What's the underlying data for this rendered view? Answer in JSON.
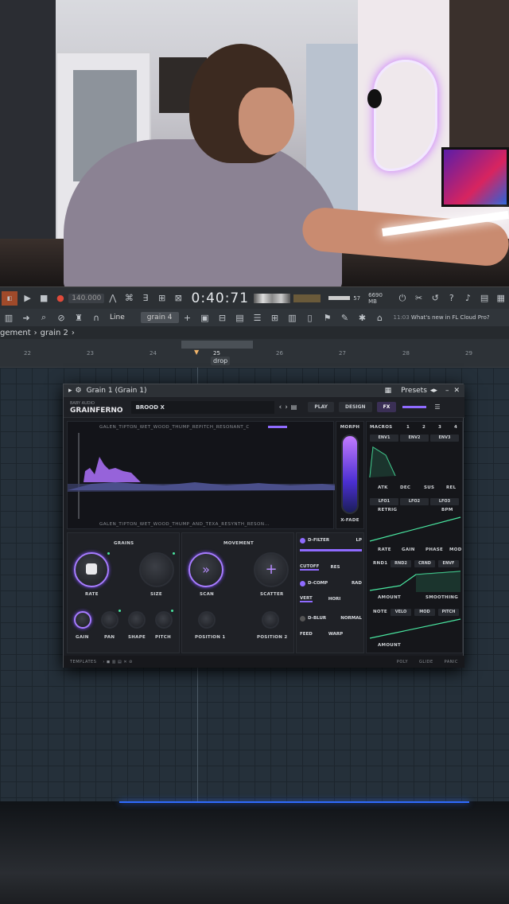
{
  "toolbar": {
    "tempo": "140.000",
    "time": "0:40:71",
    "memory": "6690 MB",
    "cpu_count": "57",
    "zero": "0",
    "snap_mode": "Line",
    "pattern": "grain 4",
    "news_time": "11:03",
    "news_text": "What's new in FL Cloud Pro?"
  },
  "breadcrumb": {
    "part1": "gement",
    "part2": "grain 2"
  },
  "ruler": {
    "ticks": [
      "22",
      "23",
      "24",
      "25",
      "26",
      "27",
      "28",
      "29"
    ],
    "marker": "drop"
  },
  "plugin": {
    "window_title": "Grain 1 (Grain 1)",
    "presets_label": "Presets",
    "brand_top": "BABY AUDIO",
    "brand": "GRAINFERNO",
    "preset_name": "BROOD X",
    "play": "PLAY",
    "design": "DESIGN",
    "fx": "FX",
    "sample_top": "GALEN_TIPTON_WET_WOOD_THUMP_REPITCH_RESONANT_C",
    "sample_bottom": "GALEN_TIPTON_WET_WOOD_THUMP_AND_TEXA_RESYNTH_RESON...",
    "morph": "MORPH",
    "xfade": "X-FADE",
    "macros": "MACROS",
    "macro_nums": [
      "1",
      "2",
      "3",
      "4"
    ],
    "env_tabs": [
      "ENV1",
      "ENV2",
      "ENV3"
    ],
    "env_params": [
      "ATK",
      "DEC",
      "SUS",
      "REL"
    ],
    "lfo_tabs": [
      "LFO1",
      "LFO2",
      "LFO3"
    ],
    "retrig": "RETRIG",
    "bpm": "BPM",
    "lfo_params": [
      "RATE",
      "GAIN",
      "PHASE",
      "MOD"
    ],
    "rnd_tabs": [
      "RND1",
      "RND2",
      "CRND",
      "ENVF"
    ],
    "amount": "AMOUNT",
    "smoothing": "SMOOTHING",
    "note_tabs": [
      "NOTE",
      "VELO",
      "MOD",
      "PITCH"
    ],
    "amount2": "AMOUNT",
    "grains": "GRAINS",
    "grain_knobs": [
      "RATE",
      "SIZE"
    ],
    "grain_small": [
      "GAIN",
      "PAN",
      "SHAPE",
      "PITCH"
    ],
    "movement": "MOVEMENT",
    "move_knobs": [
      "SCAN",
      "SCATTER"
    ],
    "positions": [
      "POSITION 1",
      "POSITION 2"
    ],
    "dfilter": "D-FILTER",
    "lp": "LP",
    "cutoff": "CUTOFF",
    "res": "RES",
    "dcomp": "D-COMP",
    "rad": "RAD",
    "vert": "VERT",
    "hori": "HORI",
    "dblur": "D-BLUR",
    "normal": "NORMAL",
    "feed": "FEED",
    "warp": "WARP",
    "templates": "TEMPLATES",
    "poly": "POLY",
    "glide": "GLIDE",
    "panic": "PANIC"
  },
  "colors": {
    "accent": "#8f6bff",
    "green": "#49e6a0",
    "bg": "#1b1d22"
  }
}
